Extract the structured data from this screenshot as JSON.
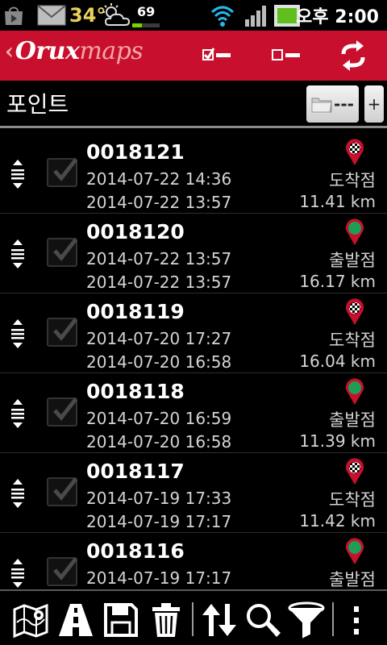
{
  "status_bar": {
    "temperature": "34°",
    "battery_level": "69",
    "battery_fraction": 0.35,
    "time": "오후 2:00"
  },
  "header": {
    "logo_left": "Orux",
    "logo_right": "maps"
  },
  "section": {
    "title": "포인트",
    "folder_label": "---",
    "plus_label": "+"
  },
  "points": [
    {
      "name": "0018121",
      "date1": "2014-07-22 14:36",
      "date2": "2014-07-22 13:57",
      "type": "도착점",
      "distance": "11.41  km",
      "marker": "finish-flag-icon"
    },
    {
      "name": "0018120",
      "date1": "2014-07-22 13:57",
      "date2": "2014-07-22 13:57",
      "type": "출발점",
      "distance": "16.17  km",
      "marker": "start-pin-icon"
    },
    {
      "name": "0018119",
      "date1": "2014-07-20 17:27",
      "date2": "2014-07-20 16:58",
      "type": "도착점",
      "distance": "16.04  km",
      "marker": "finish-flag-icon"
    },
    {
      "name": "0018118",
      "date1": "2014-07-20 16:59",
      "date2": "2014-07-20 16:58",
      "type": "출발점",
      "distance": "11.39  km",
      "marker": "start-pin-icon"
    },
    {
      "name": "0018117",
      "date1": "2014-07-19 17:33",
      "date2": "2014-07-19 17:17",
      "type": "도착점",
      "distance": "11.42  km",
      "marker": "finish-flag-icon"
    },
    {
      "name": "0018116",
      "date1": "2014-07-19 17:17",
      "date2": "",
      "type": "출발점",
      "distance": "",
      "marker": "start-pin-icon"
    }
  ],
  "toolbar_icons": [
    "map-icon",
    "road-icon",
    "save-icon",
    "trash-icon",
    "sort-icon",
    "search-icon",
    "filter-icon",
    "overflow-menu-icon"
  ],
  "colors": {
    "header": "#c8102e",
    "pin_green": "#1f9d55",
    "pin_red": "#c8102e"
  }
}
